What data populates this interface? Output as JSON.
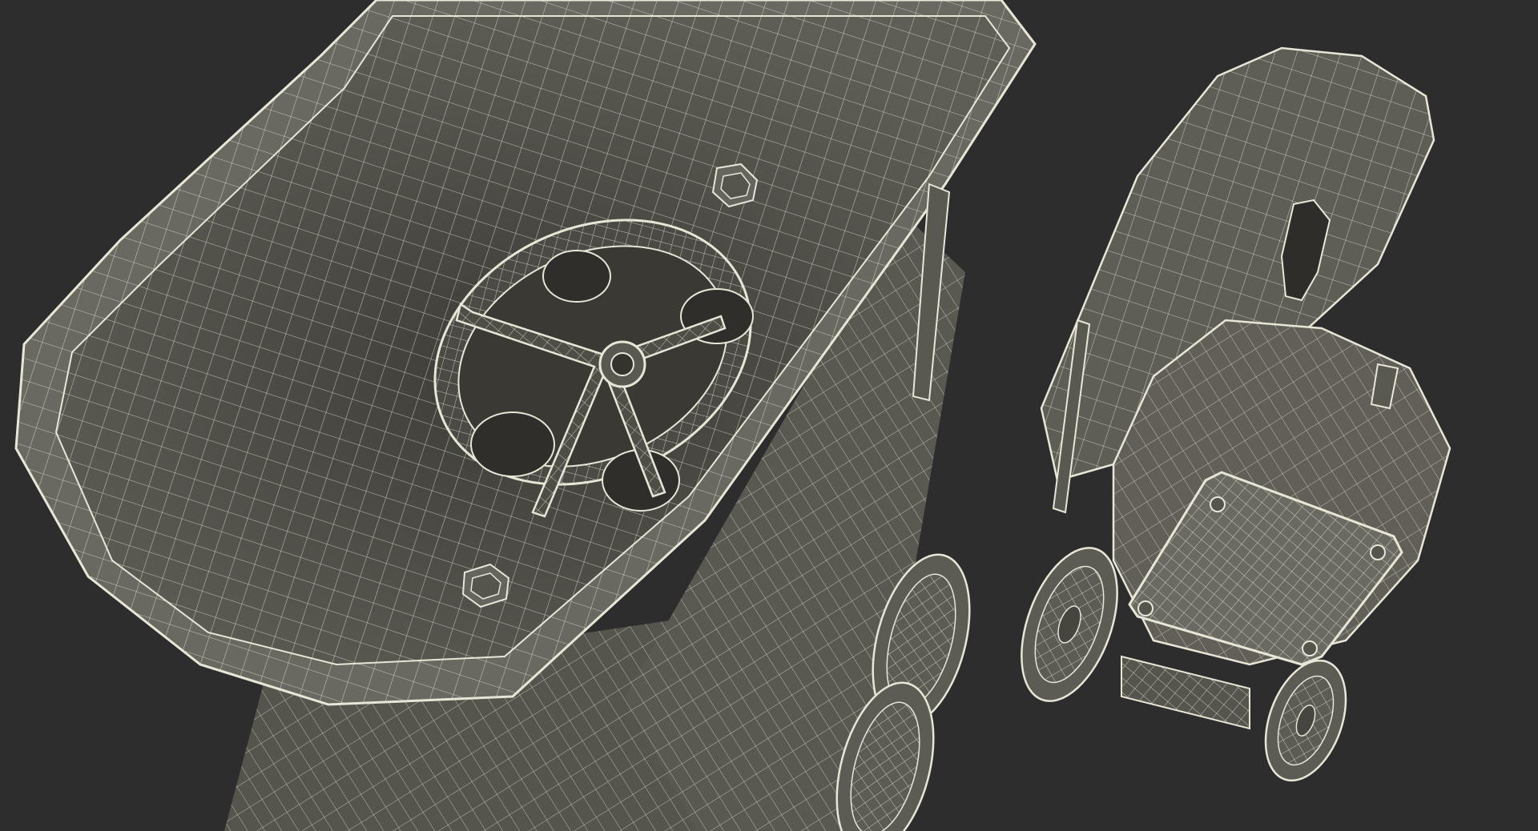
{
  "scene": {
    "subject": "wireframe-render",
    "colors": {
      "background": "#2d2d2d",
      "surface": "#5b5a53",
      "surface_dark": "#3f3e39",
      "surface_light": "#6e6d65",
      "wire": "#e8e6d6"
    }
  }
}
